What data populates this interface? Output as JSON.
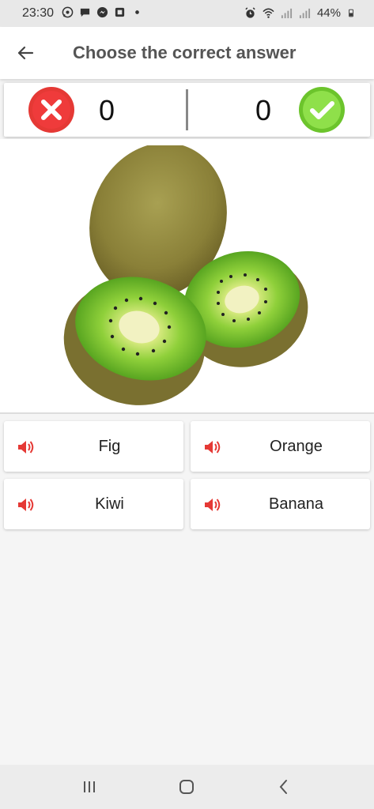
{
  "status_bar": {
    "time": "23:30",
    "battery": "44%",
    "notification_icons": [
      "whatsapp-icon",
      "message-icon",
      "messenger-icon",
      "app-icon",
      "dot-icon"
    ],
    "system_icons": [
      "alarm-icon",
      "wifi-icon",
      "signal-icon",
      "signal-icon",
      "battery-icon"
    ]
  },
  "header": {
    "title": "Choose the correct answer",
    "back_icon": "arrow-left-icon"
  },
  "score": {
    "wrong_count": "0",
    "right_count": "0",
    "wrong_color": "#e53935",
    "right_color": "#7cd635"
  },
  "question": {
    "image": "kiwi-fruit-image"
  },
  "answers": [
    {
      "label": "Fig",
      "icon": "speaker-icon"
    },
    {
      "label": "Orange",
      "icon": "speaker-icon"
    },
    {
      "label": "Kiwi",
      "icon": "speaker-icon"
    },
    {
      "label": "Banana",
      "icon": "speaker-icon"
    }
  ],
  "colors": {
    "accent": "#e53935",
    "title_text": "#555555"
  },
  "nav_bar": {
    "buttons": [
      "recents-icon",
      "home-icon",
      "back-icon"
    ]
  }
}
